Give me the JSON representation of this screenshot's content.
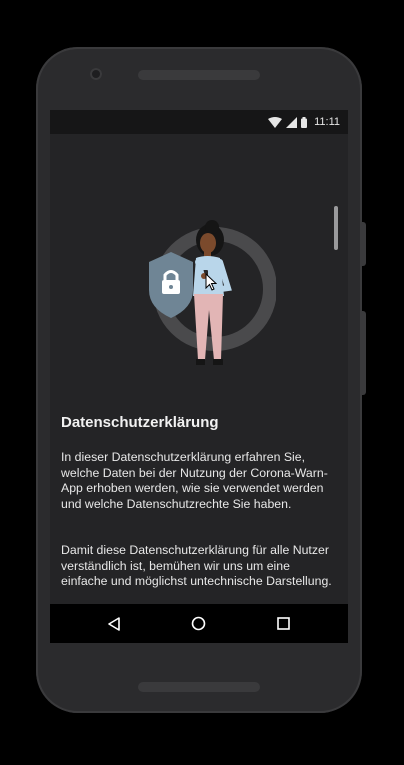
{
  "statusbar": {
    "time": "11:11",
    "icons": [
      "wifi-icon",
      "cell-signal-icon",
      "battery-icon"
    ]
  },
  "page": {
    "title": "Datenschutzerklärung",
    "paragraph1": "In dieser Datenschutzerklärung erfahren Sie, welche Daten bei der Nutzung der Corona-Warn-App erhoben werden, wie sie verwendet werden und welche Datenschutzrechte Sie haben.",
    "paragraph2": "Damit diese Datenschutzerklärung für alle Nutzer verständlich ist, bemühen wir uns um eine einfache und möglichst untechnische Darstellung."
  },
  "navbar": {
    "buttons": [
      "back-icon",
      "home-icon",
      "recents-icon"
    ]
  },
  "colors": {
    "background": "#242426",
    "shield": "#6f8595",
    "ring": "#4a4a4c",
    "shirt": "#b9d6ea",
    "pants": "#e2b5b5",
    "skin": "#7b4a2c"
  }
}
